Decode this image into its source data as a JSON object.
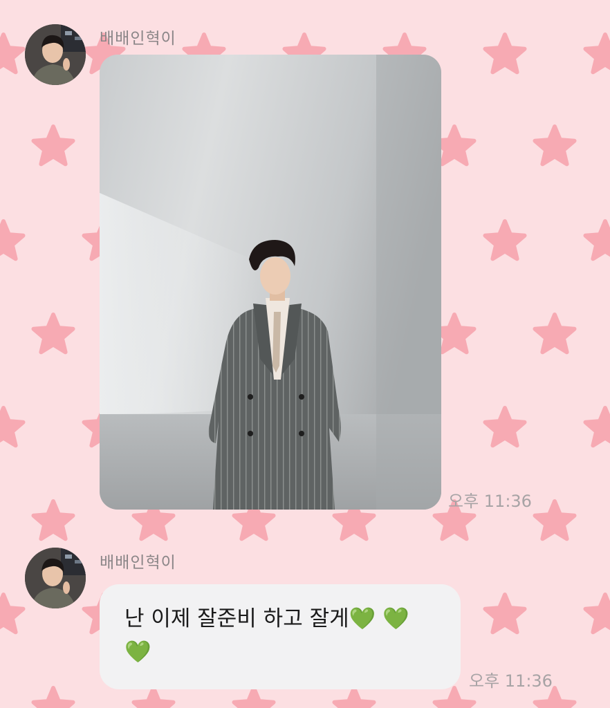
{
  "messages": [
    {
      "sender": "배배인혁이",
      "type": "photo",
      "time": "오후 11:36"
    },
    {
      "sender": "배배인혁이",
      "type": "text",
      "text": "난 이제 잘준비 하고 잘게💚 💚 💚",
      "time": "오후 11:36"
    }
  ],
  "icons": {
    "background": "star-pattern",
    "emoji": "green-heart"
  },
  "colors": {
    "background": "#fcdfe2",
    "star": "#f7aab3",
    "bubble": "#f2f2f3",
    "timestamp": "#a7a3a5"
  }
}
